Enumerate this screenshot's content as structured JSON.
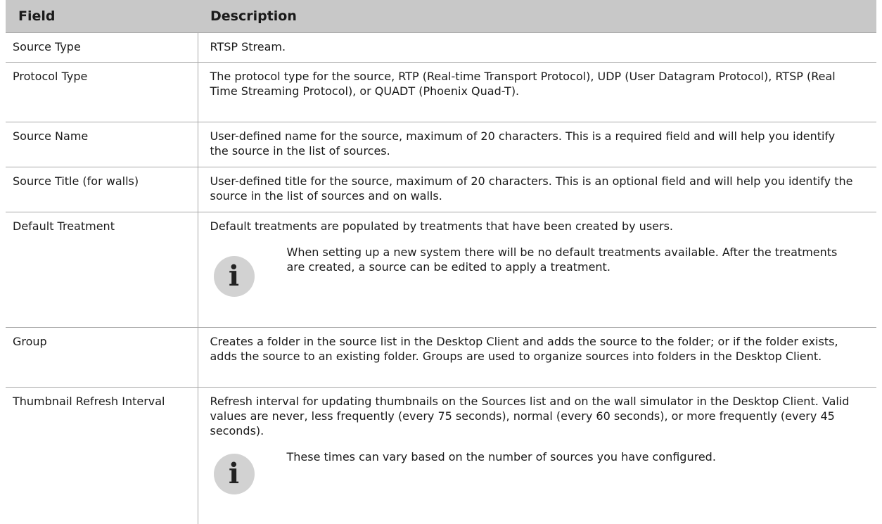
{
  "table": {
    "headers": [
      "Field",
      "Description"
    ],
    "rows": [
      {
        "field": "Source Type",
        "description": "RTSP Stream."
      },
      {
        "field": "Protocol Type",
        "description": "The protocol type for the source, RTP (Real-time Transport Protocol), UDP (User Datagram Protocol), RTSP (Real Time Streaming Protocol), or QUADT (Phoenix Quad-T)."
      },
      {
        "field": "Source Name",
        "description": "User-defined name for the source, maximum of 20 characters. This is a required field and will help you identify the source in the list of sources."
      },
      {
        "field": "Source Title (for walls)",
        "description": "User-defined title for the source, maximum of 20 characters. This is an optional field and will help you identify the source in the list of sources and on walls."
      },
      {
        "field": "Default Treatment",
        "description": "Default treatments are populated by treatments that have been created by users.",
        "note": "When setting up a new system there will be no default treatments available. After the treatments are created, a source can be edited to apply a treatment."
      },
      {
        "field": "Group",
        "description": "Creates a folder in the source list in the Desktop Client and adds the source to the folder; or if the folder exists, adds the source to an existing folder. Groups are used to organize sources into folders in the Desktop Client."
      },
      {
        "field": "Thumbnail Refresh Interval",
        "description": "Refresh interval for updating thumbnails on the Sources list and on the wall simulator in the Desktop Client. Valid values are never, less frequently (every 75 seconds), normal (every 60 seconds), or more frequently (every 45 seconds).",
        "note": "These times can vary based on the number of sources you have configured."
      }
    ]
  },
  "icons": {
    "note_icon": "info-icon",
    "note_glyph": "i"
  },
  "colors": {
    "header_bg": "#c8c8c8",
    "icon_bg": "#d2d2d2",
    "rule": "#a8a8a8"
  }
}
